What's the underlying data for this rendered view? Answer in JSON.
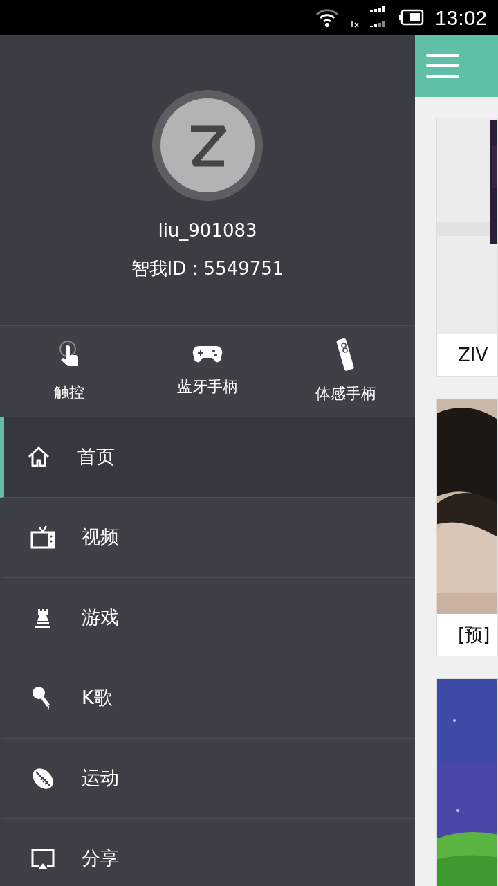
{
  "status_bar": {
    "time": "13:02"
  },
  "drawer": {
    "profile": {
      "username": "liu_901083",
      "user_id": "智我ID : 5549751"
    },
    "quick_actions": [
      {
        "label": "触控",
        "kind": "touch"
      },
      {
        "label": "蓝牙手柄",
        "kind": "gamepad"
      },
      {
        "label": "体感手柄",
        "kind": "remote"
      }
    ],
    "menu": [
      {
        "label": "首页",
        "kind": "home",
        "selected": true
      },
      {
        "label": "视频",
        "kind": "tv",
        "selected": false
      },
      {
        "label": "游戏",
        "kind": "chess",
        "selected": false
      },
      {
        "label": "K歌",
        "kind": "mic",
        "selected": false
      },
      {
        "label": "运动",
        "kind": "ball",
        "selected": false
      },
      {
        "label": "分享",
        "kind": "cast",
        "selected": false
      }
    ]
  },
  "content": {
    "cards": [
      {
        "kind": "picture",
        "caption": "ZIV"
      },
      {
        "kind": "picture",
        "caption": "[预]"
      },
      {
        "kind": "picture"
      }
    ]
  }
}
